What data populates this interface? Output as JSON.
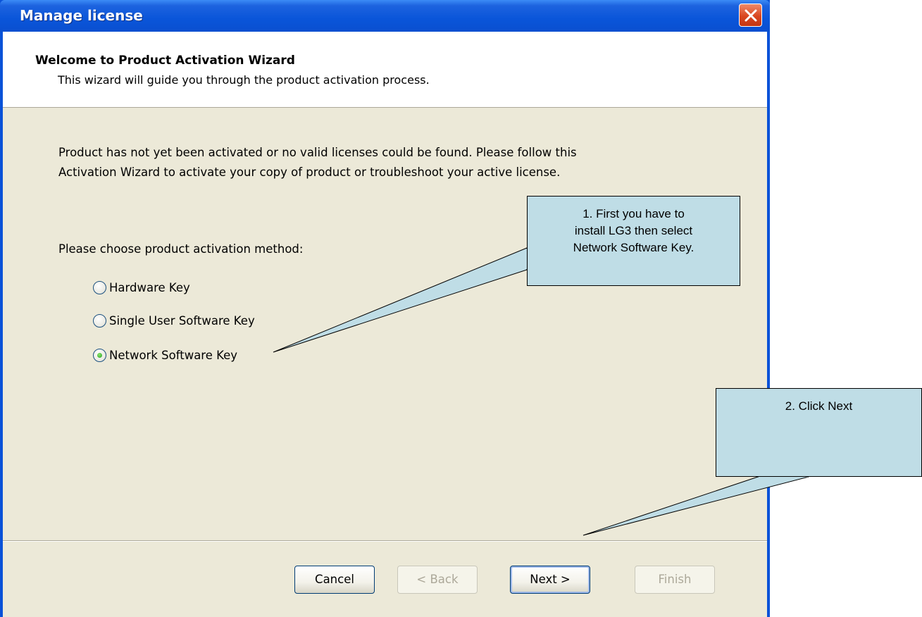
{
  "window": {
    "title": "Manage license",
    "close_icon": "close-icon"
  },
  "header": {
    "title": "Welcome to Product Activation Wizard",
    "subtitle": "This wizard will guide you through the product activation process."
  },
  "body": {
    "intro_line1": "Product has not yet been activated or no valid licenses could be found. Please follow this",
    "intro_line2": "Activation Wizard to activate your copy of product or troubleshoot your active license.",
    "choose_label": "Please choose product activation method:",
    "options": [
      {
        "label": "Hardware Key",
        "selected": false
      },
      {
        "label": "Single User Software Key",
        "selected": false
      },
      {
        "label": "Network Software Key",
        "selected": true
      }
    ]
  },
  "buttons": {
    "cancel": "Cancel",
    "back": "< Back",
    "next": "Next >",
    "finish": "Finish"
  },
  "callouts": {
    "step1_line1": "1. First you have to",
    "step1_line2": "install LG3 then select",
    "step1_line3": "Network Software Key.",
    "step2": "2. Click Next"
  },
  "colors": {
    "titlebar": "#0a55d9",
    "dialog_bg": "#ece9d8",
    "callout_bg": "#bfdde6"
  }
}
